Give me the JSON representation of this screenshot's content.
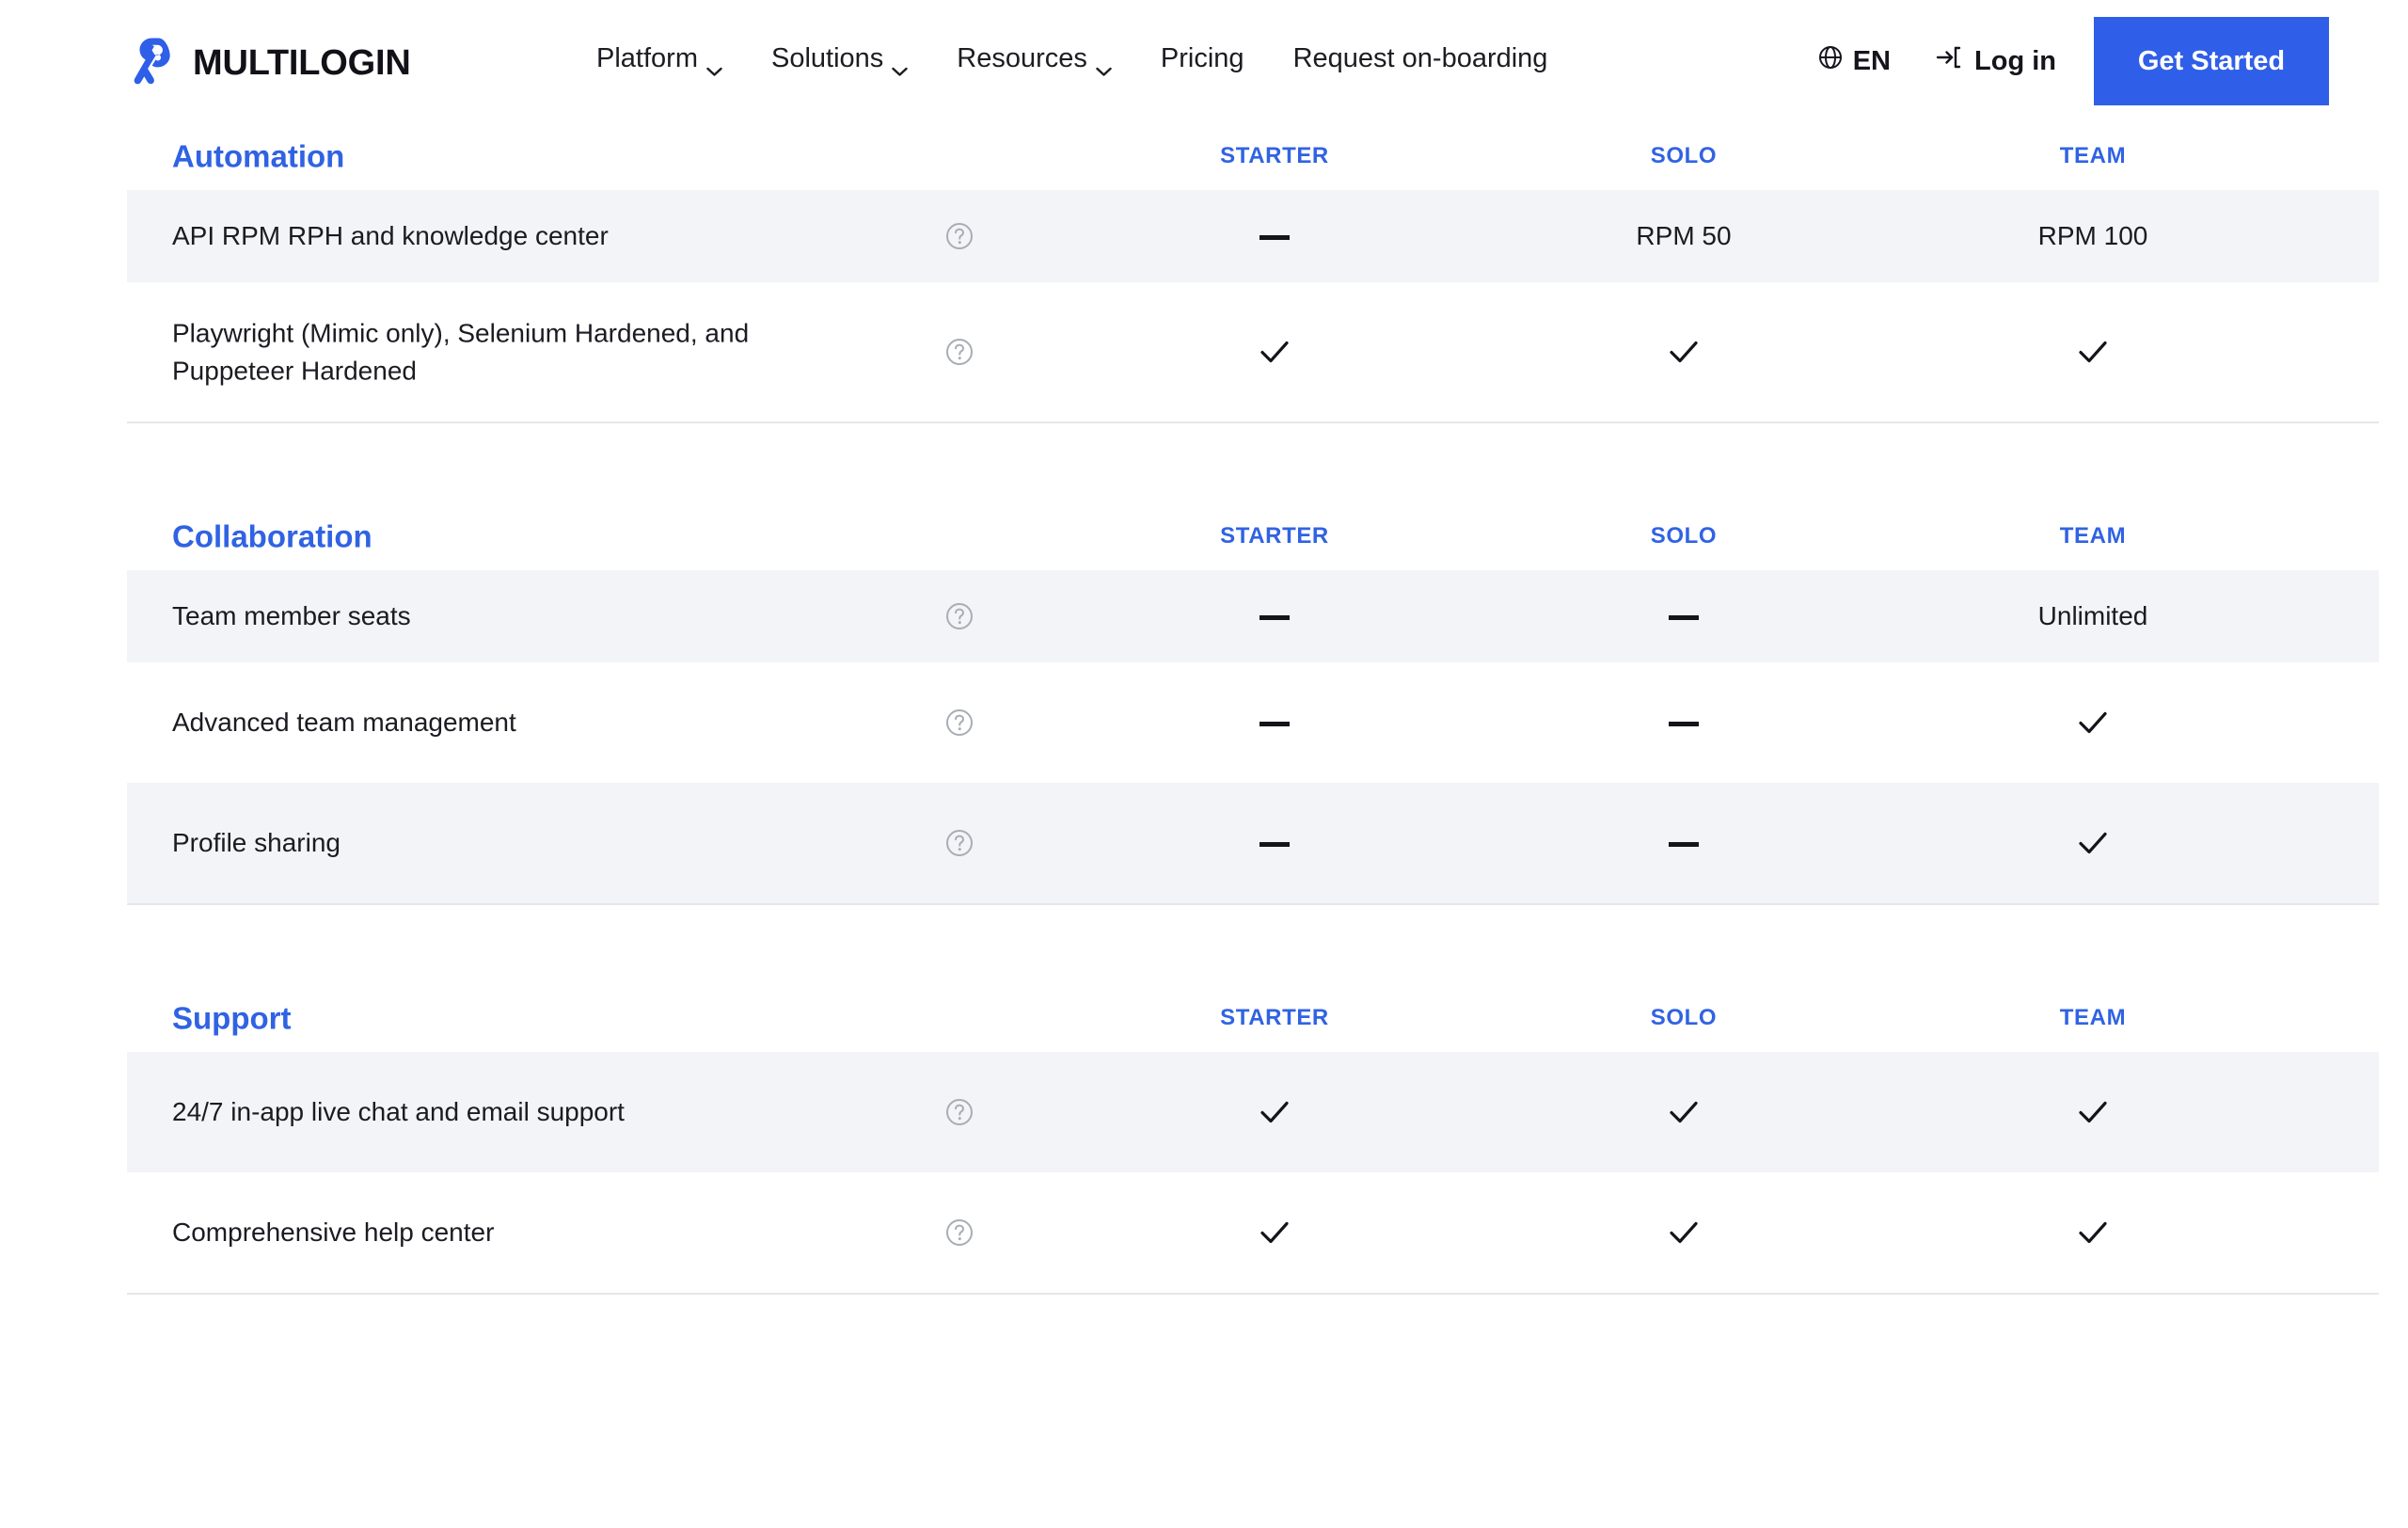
{
  "brand": {
    "name": "MULTILOGIN",
    "logo_icon": "multilogin-ribbon-logo",
    "accent_color": "#2f5fe8",
    "heading_color": "#3063e3"
  },
  "header": {
    "nav": [
      {
        "label": "Platform",
        "has_caret": true,
        "icon": "chevron-down-icon"
      },
      {
        "label": "Solutions",
        "has_caret": true,
        "icon": "chevron-down-icon"
      },
      {
        "label": "Resources",
        "has_caret": true,
        "icon": "chevron-down-icon"
      },
      {
        "label": "Pricing",
        "has_caret": false,
        "icon": ""
      },
      {
        "label": "Request on-boarding",
        "has_caret": false,
        "icon": ""
      }
    ],
    "language": {
      "label": "EN",
      "icon": "globe-icon"
    },
    "login": {
      "label": "Log in",
      "icon": "login-arrow-icon"
    },
    "cta": {
      "label": "Get Started"
    }
  },
  "table": {
    "columns": [
      "STARTER",
      "SOLO",
      "TEAM"
    ],
    "help_icon": "question-circle-icon",
    "check_icon": "checkmark-icon",
    "dash_icon": "dash-icon",
    "sections": [
      {
        "title": "Automation",
        "rows": [
          {
            "label": "API RPM RPH and knowledge center",
            "shaded": true,
            "height": 98,
            "values": [
              {
                "type": "dash",
                "text": ""
              },
              {
                "type": "text",
                "text": "RPM 50"
              },
              {
                "type": "text",
                "text": "RPM 100"
              }
            ]
          },
          {
            "label": "Playwright (Mimic only), Selenium Hardened, and Puppeteer Hardened",
            "shaded": false,
            "height": 148,
            "values": [
              {
                "type": "check",
                "text": ""
              },
              {
                "type": "check",
                "text": ""
              },
              {
                "type": "check",
                "text": ""
              }
            ]
          }
        ]
      },
      {
        "title": "Collaboration",
        "rows": [
          {
            "label": "Team member seats",
            "shaded": true,
            "height": 98,
            "values": [
              {
                "type": "dash",
                "text": ""
              },
              {
                "type": "dash",
                "text": ""
              },
              {
                "type": "text",
                "text": "Unlimited"
              }
            ]
          },
          {
            "label": "Advanced team management",
            "shaded": false,
            "height": 128,
            "values": [
              {
                "type": "dash",
                "text": ""
              },
              {
                "type": "dash",
                "text": ""
              },
              {
                "type": "check",
                "text": ""
              }
            ]
          },
          {
            "label": "Profile sharing",
            "shaded": true,
            "height": 128,
            "values": [
              {
                "type": "dash",
                "text": ""
              },
              {
                "type": "dash",
                "text": ""
              },
              {
                "type": "check",
                "text": ""
              }
            ]
          }
        ]
      },
      {
        "title": "Support",
        "rows": [
          {
            "label": "24/7 in-app live chat and email support",
            "shaded": true,
            "height": 128,
            "values": [
              {
                "type": "check",
                "text": ""
              },
              {
                "type": "check",
                "text": ""
              },
              {
                "type": "check",
                "text": ""
              }
            ]
          },
          {
            "label": "Comprehensive help center",
            "shaded": false,
            "height": 128,
            "values": [
              {
                "type": "check",
                "text": ""
              },
              {
                "type": "check",
                "text": ""
              },
              {
                "type": "check",
                "text": ""
              }
            ]
          }
        ]
      }
    ]
  }
}
